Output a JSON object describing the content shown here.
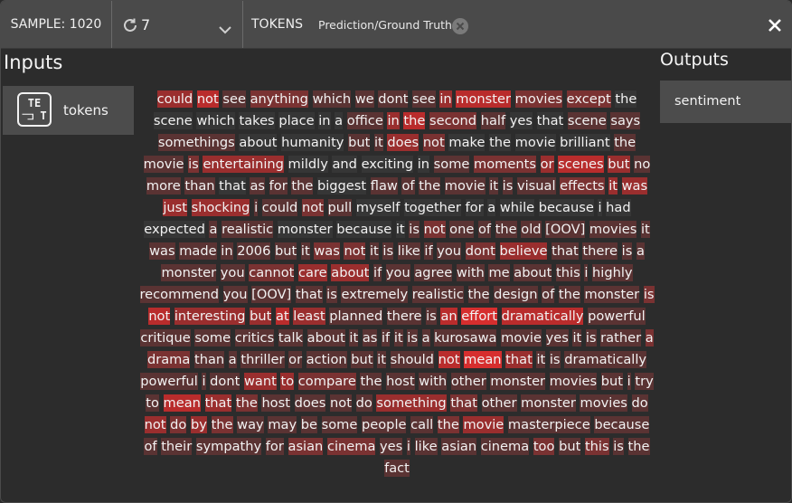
{
  "toolbar": {
    "sample_label": "SAMPLE: 1020",
    "seed_value": "7",
    "tokens_label": "TOKENS",
    "prediction_label": "Prediction/Ground Truth"
  },
  "inputs": {
    "title": "Inputs",
    "field_label": "tokens",
    "field_icon_text": [
      "TE",
      "⫎ T"
    ]
  },
  "outputs": {
    "title": "Outputs",
    "field_label": "sentiment"
  },
  "highlight_colors": {
    "level0": "rgba(255,255,255,0.05)",
    "level1": "#5a3333",
    "level2": "#7a3232",
    "level3": "#9a2e2e",
    "level4": "#b92c2c",
    "level5": "#d62e2e"
  },
  "tokens": [
    [
      "could",
      3
    ],
    [
      "not",
      4
    ],
    [
      "see",
      1
    ],
    [
      "anything",
      2
    ],
    [
      "which",
      1
    ],
    [
      "we",
      1
    ],
    [
      "dont",
      1
    ],
    [
      "see",
      1
    ],
    [
      "in",
      3
    ],
    [
      "monster",
      4
    ],
    [
      "movies",
      2
    ],
    [
      "except",
      2
    ],
    [
      "the",
      0
    ],
    [
      "scene",
      0
    ],
    [
      "which",
      0
    ],
    [
      "takes",
      0
    ],
    [
      "place",
      0
    ],
    [
      "in",
      0
    ],
    [
      "a",
      0
    ],
    [
      "office",
      1
    ],
    [
      "in",
      3
    ],
    [
      "the",
      4
    ],
    [
      "second",
      2
    ],
    [
      "half",
      1
    ],
    [
      "yes",
      0
    ],
    [
      "that",
      0
    ],
    [
      "scene",
      1
    ],
    [
      "says",
      1
    ],
    [
      "somethings",
      1
    ],
    [
      "about",
      0
    ],
    [
      "humanity",
      0
    ],
    [
      "but",
      1
    ],
    [
      "it",
      1
    ],
    [
      "does",
      3
    ],
    [
      "not",
      2
    ],
    [
      "make",
      0
    ],
    [
      "the",
      0
    ],
    [
      "movie",
      0
    ],
    [
      "brilliant",
      0
    ],
    [
      "the",
      1
    ],
    [
      "movie",
      1
    ],
    [
      "is",
      2
    ],
    [
      "entertaining",
      3
    ],
    [
      "mildly",
      0
    ],
    [
      "and",
      0
    ],
    [
      "exciting",
      0
    ],
    [
      "in",
      0
    ],
    [
      "some",
      1
    ],
    [
      "moments",
      2
    ],
    [
      "or",
      3
    ],
    [
      "scenes",
      4
    ],
    [
      "but",
      3
    ],
    [
      "no",
      1
    ],
    [
      "more",
      1
    ],
    [
      "than",
      1
    ],
    [
      "that",
      0
    ],
    [
      "as",
      1
    ],
    [
      "for",
      1
    ],
    [
      "the",
      1
    ],
    [
      "biggest",
      0
    ],
    [
      "flaw",
      1
    ],
    [
      "of",
      1
    ],
    [
      "the",
      1
    ],
    [
      "movie",
      1
    ],
    [
      "it",
      1
    ],
    [
      "is",
      1
    ],
    [
      "visual",
      1
    ],
    [
      "effects",
      2
    ],
    [
      "it",
      3
    ],
    [
      "was",
      3
    ],
    [
      "just",
      3
    ],
    [
      "shocking",
      3
    ],
    [
      "i",
      1
    ],
    [
      "could",
      1
    ],
    [
      "not",
      2
    ],
    [
      "pull",
      1
    ],
    [
      "myself",
      0
    ],
    [
      "together",
      0
    ],
    [
      "for",
      0
    ],
    [
      "a",
      0
    ],
    [
      "while",
      0
    ],
    [
      "because",
      0
    ],
    [
      "i",
      0
    ],
    [
      "had",
      0
    ],
    [
      "expected",
      0
    ],
    [
      "a",
      1
    ],
    [
      "realistic",
      1
    ],
    [
      "monster",
      0
    ],
    [
      "because",
      0
    ],
    [
      "it",
      0
    ],
    [
      "is",
      1
    ],
    [
      "not",
      2
    ],
    [
      "one",
      1
    ],
    [
      "of",
      1
    ],
    [
      "the",
      1
    ],
    [
      "old",
      1
    ],
    [
      "[OOV]",
      1
    ],
    [
      "movies",
      1
    ],
    [
      "it",
      1
    ],
    [
      "was",
      1
    ],
    [
      "made",
      1
    ],
    [
      "in",
      1
    ],
    [
      "2006",
      1
    ],
    [
      "but",
      1
    ],
    [
      "it",
      1
    ],
    [
      "was",
      2
    ],
    [
      "not",
      2
    ],
    [
      "it",
      1
    ],
    [
      "is",
      1
    ],
    [
      "like",
      1
    ],
    [
      "if",
      1
    ],
    [
      "you",
      1
    ],
    [
      "dont",
      2
    ],
    [
      "believe",
      3
    ],
    [
      "that",
      1
    ],
    [
      "there",
      1
    ],
    [
      "is",
      1
    ],
    [
      "a",
      1
    ],
    [
      "monster",
      1
    ],
    [
      "you",
      1
    ],
    [
      "cannot",
      2
    ],
    [
      "care",
      3
    ],
    [
      "about",
      3
    ],
    [
      "if",
      1
    ],
    [
      "you",
      1
    ],
    [
      "agree",
      1
    ],
    [
      "with",
      1
    ],
    [
      "me",
      1
    ],
    [
      "about",
      1
    ],
    [
      "this",
      1
    ],
    [
      "i",
      1
    ],
    [
      "highly",
      1
    ],
    [
      "recommend",
      1
    ],
    [
      "you",
      1
    ],
    [
      "[OOV]",
      1
    ],
    [
      "that",
      1
    ],
    [
      "is",
      1
    ],
    [
      "extremely",
      1
    ],
    [
      "realistic",
      1
    ],
    [
      "the",
      1
    ],
    [
      "design",
      1
    ],
    [
      "of",
      1
    ],
    [
      "the",
      1
    ],
    [
      "monster",
      1
    ],
    [
      "is",
      2
    ],
    [
      "not",
      4
    ],
    [
      "interesting",
      3
    ],
    [
      "but",
      3
    ],
    [
      "at",
      4
    ],
    [
      "least",
      3
    ],
    [
      "planned",
      1
    ],
    [
      "there",
      1
    ],
    [
      "is",
      1
    ],
    [
      "an",
      4
    ],
    [
      "effort",
      5
    ],
    [
      "dramatically",
      4
    ],
    [
      "powerful",
      1
    ],
    [
      "critique",
      1
    ],
    [
      "some",
      1
    ],
    [
      "critics",
      1
    ],
    [
      "talk",
      1
    ],
    [
      "about",
      1
    ],
    [
      "it",
      1
    ],
    [
      "as",
      1
    ],
    [
      "if",
      1
    ],
    [
      "it",
      1
    ],
    [
      "is",
      1
    ],
    [
      "a",
      1
    ],
    [
      "kurosawa",
      1
    ],
    [
      "movie",
      1
    ],
    [
      "yes",
      1
    ],
    [
      "it",
      1
    ],
    [
      "is",
      1
    ],
    [
      "rather",
      1
    ],
    [
      "a",
      2
    ],
    [
      "drama",
      2
    ],
    [
      "than",
      1
    ],
    [
      "a",
      1
    ],
    [
      "thriller",
      1
    ],
    [
      "or",
      1
    ],
    [
      "action",
      1
    ],
    [
      "but",
      1
    ],
    [
      "it",
      1
    ],
    [
      "should",
      1
    ],
    [
      "not",
      4
    ],
    [
      "mean",
      5
    ],
    [
      "that",
      3
    ],
    [
      "it",
      1
    ],
    [
      "is",
      1
    ],
    [
      "dramatically",
      1
    ],
    [
      "powerful",
      1
    ],
    [
      "i",
      1
    ],
    [
      "dont",
      1
    ],
    [
      "want",
      3
    ],
    [
      "to",
      3
    ],
    [
      "compare",
      2
    ],
    [
      "the",
      1
    ],
    [
      "host",
      1
    ],
    [
      "with",
      1
    ],
    [
      "other",
      1
    ],
    [
      "monster",
      1
    ],
    [
      "movies",
      1
    ],
    [
      "but",
      1
    ],
    [
      "i",
      1
    ],
    [
      "try",
      1
    ],
    [
      "to",
      1
    ],
    [
      "mean",
      4
    ],
    [
      "that",
      3
    ],
    [
      "the",
      2
    ],
    [
      "host",
      1
    ],
    [
      "does",
      1
    ],
    [
      "not",
      1
    ],
    [
      "do",
      1
    ],
    [
      "something",
      3
    ],
    [
      "that",
      2
    ],
    [
      "other",
      1
    ],
    [
      "monster",
      1
    ],
    [
      "movies",
      1
    ],
    [
      "do",
      1
    ],
    [
      "not",
      3
    ],
    [
      "do",
      2
    ],
    [
      "by",
      3
    ],
    [
      "the",
      2
    ],
    [
      "way",
      1
    ],
    [
      "may",
      1
    ],
    [
      "be",
      1
    ],
    [
      "some",
      1
    ],
    [
      "people",
      1
    ],
    [
      "call",
      1
    ],
    [
      "the",
      2
    ],
    [
      "movie",
      3
    ],
    [
      "masterpiece",
      1
    ],
    [
      "because",
      1
    ],
    [
      "of",
      1
    ],
    [
      "their",
      1
    ],
    [
      "sympathy",
      1
    ],
    [
      "for",
      1
    ],
    [
      "asian",
      2
    ],
    [
      "cinema",
      2
    ],
    [
      "yes",
      1
    ],
    [
      "i",
      1
    ],
    [
      "like",
      1
    ],
    [
      "asian",
      1
    ],
    [
      "cinema",
      1
    ],
    [
      "too",
      2
    ],
    [
      "but",
      1
    ],
    [
      "this",
      2
    ],
    [
      "is",
      1
    ],
    [
      "the",
      1
    ],
    [
      "fact",
      1
    ]
  ]
}
